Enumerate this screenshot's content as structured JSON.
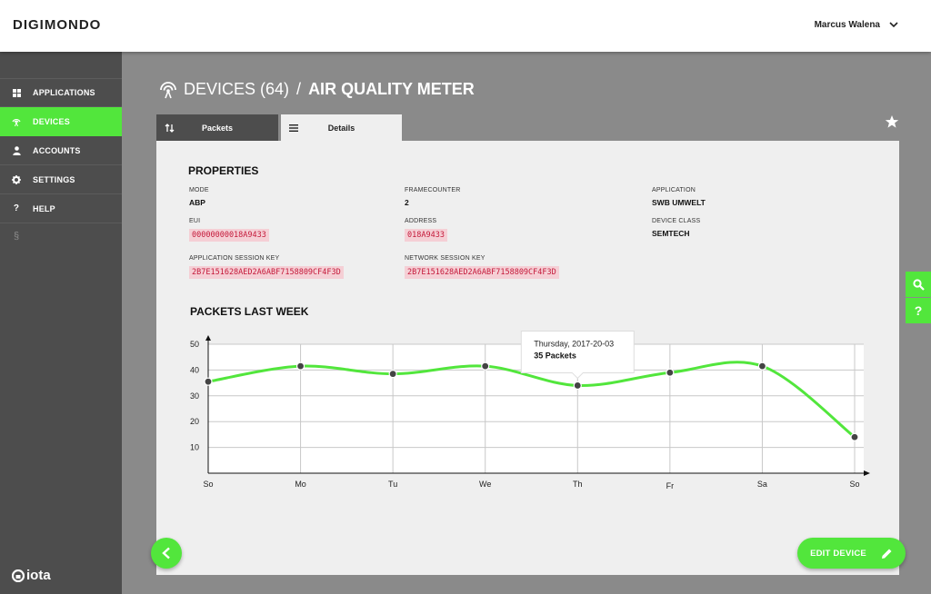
{
  "brand": "DIGIMONDO",
  "user": {
    "name": "Marcus Walena"
  },
  "nav": [
    {
      "label": "APPLICATIONS",
      "icon": "grid-icon"
    },
    {
      "label": "DEVICES",
      "icon": "antenna-icon",
      "active": true
    },
    {
      "label": "ACCOUNTS",
      "icon": "user-icon"
    },
    {
      "label": "SETTINGS",
      "icon": "gear-icon"
    },
    {
      "label": "HELP",
      "icon": "question-icon",
      "glyph": "?"
    }
  ],
  "nav_extra": "§",
  "footer_logo": "iota",
  "title": {
    "devices": "DEVICES (64)",
    "separator": "/",
    "device": "AIR QUALITY METER"
  },
  "tabs": {
    "packets": "Packets",
    "details": "Details"
  },
  "properties": {
    "heading": "PROPERTIES",
    "mode": {
      "label": "MODE",
      "value": "ABP"
    },
    "framecounter": {
      "label": "FRAMECOUNTER",
      "value": "2"
    },
    "application": {
      "label": "APPLICATION",
      "value": "SWB UMWELT"
    },
    "eui": {
      "label": "EUI",
      "value": "00000000018A9433"
    },
    "address": {
      "label": "ADDRESS",
      "value": "018A9433"
    },
    "device_class": {
      "label": "DEVICE CLASS",
      "value": "SEMTECH"
    },
    "app_session_key": {
      "label": "APPLICATION SESSION KEY",
      "value": "2B7E151628AED2A6ABF7158809CF4F3D"
    },
    "net_session_key": {
      "label": "NETWORK SESSION KEY",
      "value": "2B7E151628AED2A6ABF7158809CF4F3D"
    }
  },
  "chart_heading": "PACKETS LAST WEEK",
  "chart_data": {
    "type": "line",
    "categories": [
      "So",
      "Mo",
      "Tu",
      "We",
      "Th",
      "Fr",
      "Sa",
      "So"
    ],
    "values": [
      35.5,
      41.5,
      38.5,
      41.5,
      34,
      39,
      41.5,
      14
    ],
    "ylim": [
      0,
      50
    ],
    "yticks": [
      10,
      20,
      30,
      40,
      50
    ],
    "grid": true,
    "line_color": "#52e63c",
    "tooltip": {
      "index": 4,
      "date": "Thursday, 2017-20-03",
      "value": "35 Packets"
    }
  },
  "actions": {
    "edit_device": "EDIT DEVICE"
  },
  "colors": {
    "accent": "#52e63c",
    "sidebar": "#4d4d4d",
    "key_bg": "#f5cfd5",
    "key_text": "#c4193a"
  }
}
